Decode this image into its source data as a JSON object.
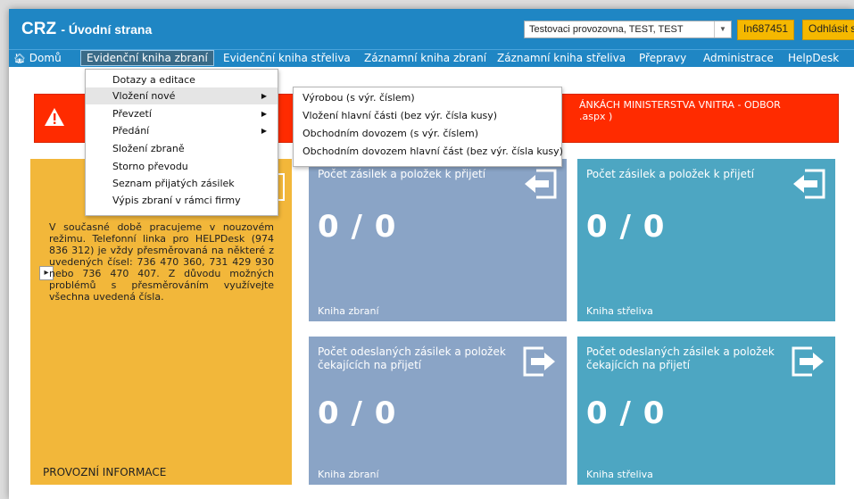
{
  "header": {
    "title": "CRZ",
    "subtitle": "- Úvodní strana",
    "org_select": "Testovaci provozovna, TEST, TEST",
    "user_id": "In687451",
    "logout": "Odhlásit se"
  },
  "nav": {
    "home": "Domů",
    "items": [
      "Evidenční kniha zbraní",
      "Evidenční kniha střeliva",
      "Záznamní kniha zbraní",
      "Záznamní kniha střeliva",
      "Přepravy",
      "Administrace",
      "HelpDesk"
    ]
  },
  "dropdown": {
    "items": [
      "Dotazy a editace",
      "Vložení nové",
      "Převzetí",
      "Předání",
      "Složení zbraně",
      "Storno převodu",
      "Seznam přijatých zásilek",
      "Výpis zbraní v rámci firmy"
    ]
  },
  "submenu": {
    "items": [
      "Výrobou (s výr. číslem)",
      "Vložení hlavní části (bez výr. čísla kusy)",
      "Obchodním dovozem (s výr. číslem)",
      "Obchodním dovozem hlavní část (bez výr. čísla kusy)"
    ]
  },
  "alert": {
    "text_line1": "ÁNKÁCH MINISTERSTVA VNITRA - ODBOR",
    "text_line2": ".aspx )"
  },
  "info_tile": {
    "text": "V současné době pracujeme v nouzovém režimu. Telefonní linka pro HELPDesk (974 836 312) je vždy přesměrovaná na některé z uvedených čísel: 736 470 360, 731 429 930 nebo 736 470 407. Z důvodu možných problémů s přesměrováním využívejte všechna uvedená čísla.",
    "label": "PROVOZNÍ INFORMACE"
  },
  "tiles": [
    {
      "title": "Počet zásilek a položek k přijetí",
      "count": "0 / 0",
      "label": "Kniha zbraní",
      "icon": "incoming-arrow-icon"
    },
    {
      "title": "Počet zásilek a položek k přijetí",
      "count": "0 / 0",
      "label": "Kniha střeliva",
      "icon": "incoming-arrow-icon"
    },
    {
      "title": "Počet odeslaných zásilek a položek čekajících na přijetí",
      "count": "0 / 0",
      "label": "Kniha zbraní",
      "icon": "outgoing-arrow-icon"
    },
    {
      "title": "Počet odeslaných zásilek a položek čekajících na přijetí",
      "count": "0 / 0",
      "label": "Kniha střeliva",
      "icon": "outgoing-arrow-icon"
    }
  ],
  "colors": {
    "brand": "#1f86c4",
    "alert": "#ff2b00",
    "info_tile": "#f2b73a",
    "tile_gray": "#8aa4c6",
    "tile_teal": "#4da6c2",
    "user_badge": "#f5b800"
  }
}
